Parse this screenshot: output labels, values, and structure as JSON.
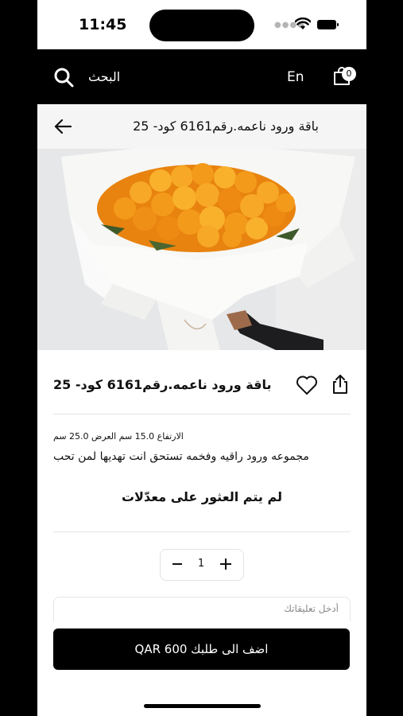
{
  "status_bar": {
    "time": "11:45"
  },
  "top_nav": {
    "search_label": "البحث",
    "language": "En",
    "cart_count": "0"
  },
  "header": {
    "title": "باقة ورود ناعمه.رقم6161 كود- 25"
  },
  "product": {
    "price_code": "باقة ورود ناعمه.رقم6161 كود- 25",
    "dimensions": "الارتفاع 15.0 سم العرض 25.0 سم",
    "description": "مجموعه ورود راقيه وفخمه تستحق انت تهديها لمن تحب",
    "no_rates": "لم يتم العثور على معدّلات",
    "quantity": "1",
    "comment_placeholder": "أدخل تعليقاتك"
  },
  "actions": {
    "add_to_order": "اضف الى طلبك QAR 600"
  },
  "colors": {
    "primary": "#000000",
    "accent_rose": "#f39a1a"
  }
}
